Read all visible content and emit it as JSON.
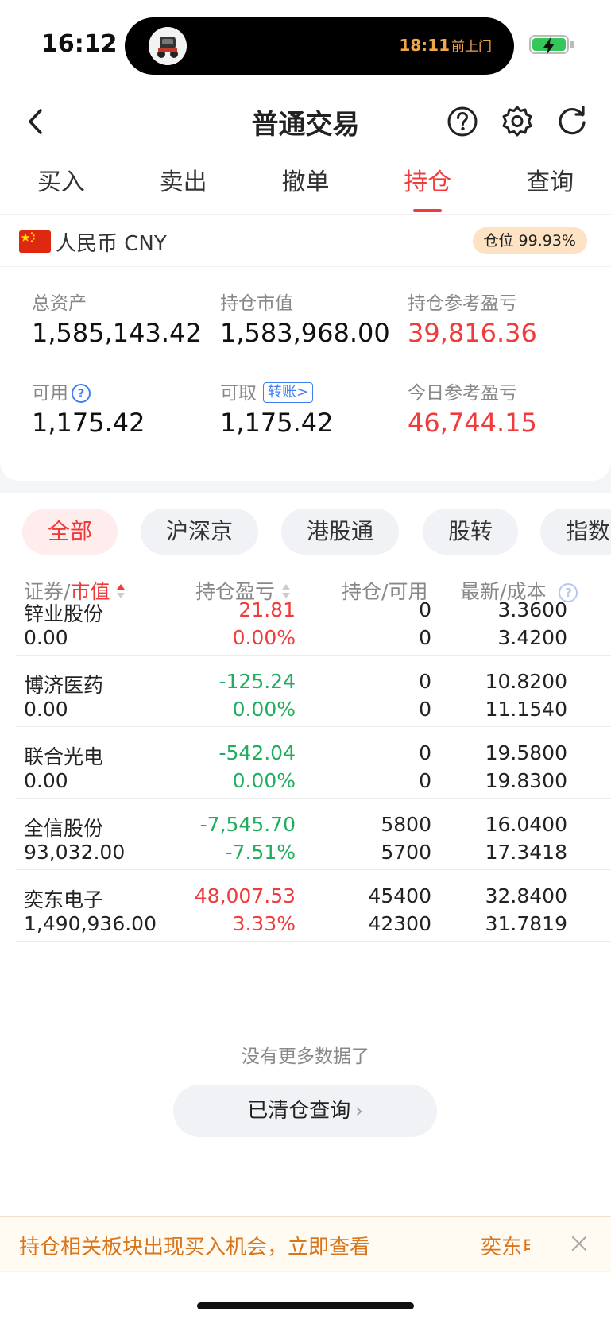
{
  "status_bar": {
    "time": "16:12",
    "live_activity_time": "18:11",
    "live_activity_text": "前上门"
  },
  "nav": {
    "title": "普通交易",
    "icons": [
      "back-icon",
      "help-icon",
      "gear-icon",
      "refresh-icon"
    ]
  },
  "tabs": [
    {
      "label": "买入",
      "active": false
    },
    {
      "label": "卖出",
      "active": false
    },
    {
      "label": "撤单",
      "active": false
    },
    {
      "label": "持仓",
      "active": true
    },
    {
      "label": "查询",
      "active": false
    }
  ],
  "account": {
    "currency": "人民币 CNY",
    "position_badge": "仓位 99.93%",
    "total_assets_label": "总资产",
    "total_assets": "1,585,143.42",
    "market_value_label": "持仓市值",
    "market_value": "1,583,968.00",
    "holding_pnl_label": "持仓参考盈亏",
    "holding_pnl": "39,816.36",
    "available_label": "可用",
    "available": "1,175.42",
    "withdrawable_label": "可取",
    "transfer_label": "转账>",
    "withdrawable": "1,175.42",
    "today_pnl_label": "今日参考盈亏",
    "today_pnl": "46,744.15"
  },
  "filters": [
    {
      "label": "全部",
      "active": true
    },
    {
      "label": "沪深京",
      "active": false
    },
    {
      "label": "港股通",
      "active": false
    },
    {
      "label": "股转",
      "active": false
    },
    {
      "label": "指数",
      "active": false
    }
  ],
  "table": {
    "headers": {
      "security": "证券",
      "market_value": "市值",
      "pnl": "持仓盈亏",
      "hold": "持仓",
      "available": "可用",
      "last": "最新",
      "cost": "成本",
      "sep": "/"
    },
    "rows": [
      {
        "name": "锌业股份",
        "market_value": "0.00",
        "pnl": "21.81",
        "pnl_pct": "0.00%",
        "tone": "red",
        "hold": "0",
        "available": "0",
        "last": "3.3600",
        "cost": "3.4200"
      },
      {
        "name": "博济医药",
        "market_value": "0.00",
        "pnl": "-125.24",
        "pnl_pct": "0.00%",
        "tone": "green",
        "hold": "0",
        "available": "0",
        "last": "10.8200",
        "cost": "11.1540"
      },
      {
        "name": "联合光电",
        "market_value": "0.00",
        "pnl": "-542.04",
        "pnl_pct": "0.00%",
        "tone": "green",
        "hold": "0",
        "available": "0",
        "last": "19.5800",
        "cost": "19.8300"
      },
      {
        "name": "全信股份",
        "market_value": "93,032.00",
        "pnl": "-7,545.70",
        "pnl_pct": "-7.51%",
        "tone": "green",
        "hold": "5800",
        "available": "5700",
        "last": "16.0400",
        "cost": "17.3418"
      },
      {
        "name": "奕东电子",
        "market_value": "1,490,936.00",
        "pnl": "48,007.53",
        "pnl_pct": "3.33%",
        "tone": "red",
        "hold": "45400",
        "available": "42300",
        "last": "32.8400",
        "cost": "31.7819"
      }
    ]
  },
  "footer": {
    "no_more": "没有更多数据了",
    "cleared_query": "已清仓查询"
  },
  "banner": {
    "text": "持仓相关板块出现买入机会，立即查看",
    "ticker": "奕东电子"
  },
  "colors": {
    "accent_red": "#f03b3b",
    "loss_green": "#1fad5e",
    "link_blue": "#3d7ff0",
    "banner_orange": "#d9761b"
  }
}
